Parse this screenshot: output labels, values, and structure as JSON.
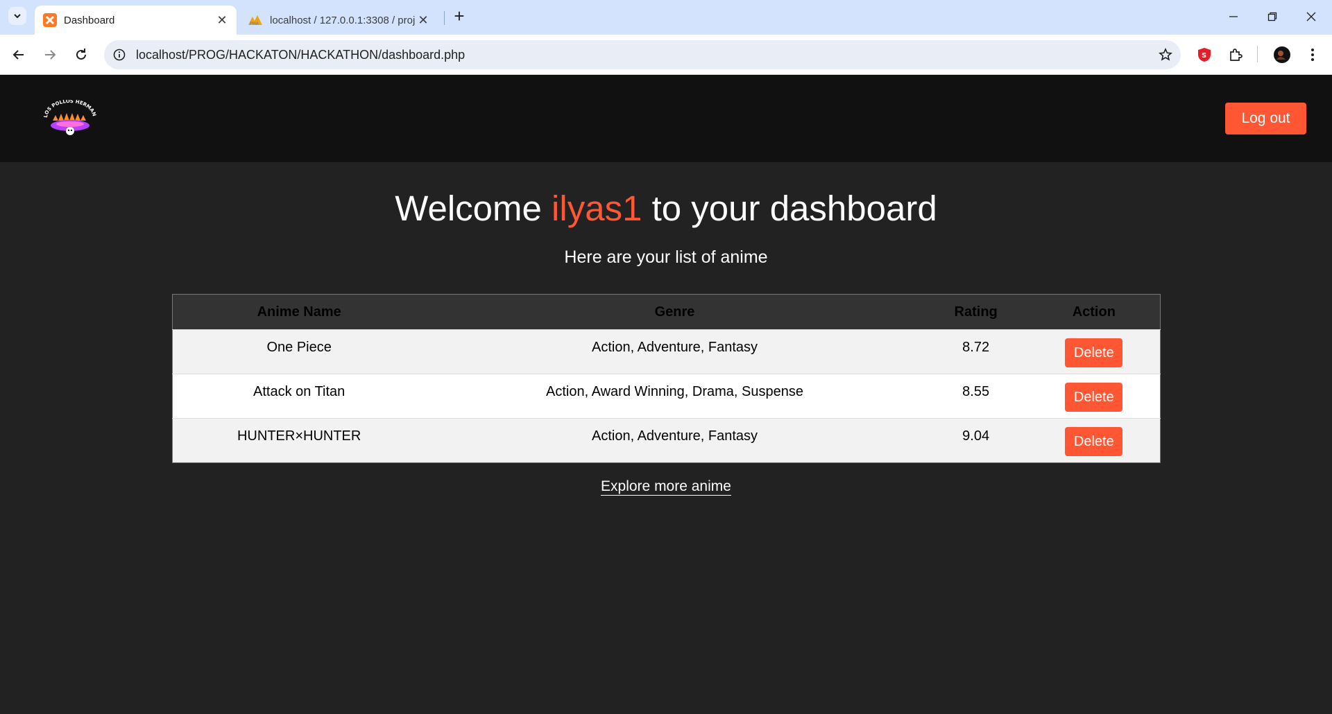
{
  "browser": {
    "tabs": [
      {
        "label": "Dashboard",
        "active": true
      },
      {
        "label": "localhost / 127.0.0.1:3308 / proj",
        "active": false
      }
    ],
    "url": "localhost/PROG/HACKATON/HACKATHON/dashboard.php"
  },
  "header": {
    "logo_text": "LOS POLLOS HERMANOS",
    "logout_label": "Log out"
  },
  "welcome": {
    "prefix": "Welcome ",
    "username": "ilyas1",
    "suffix": " to your dashboard",
    "subtitle": "Here are your list of anime"
  },
  "table": {
    "headers": {
      "name": "Anime Name",
      "genre": "Genre",
      "rating": "Rating",
      "action": "Action"
    },
    "rows": [
      {
        "name": "One Piece",
        "genre": "Action, Adventure, Fantasy",
        "rating": "8.72",
        "action": "Delete"
      },
      {
        "name": "Attack on Titan",
        "genre": "Action, Award Winning, Drama, Suspense",
        "rating": "8.55",
        "action": "Delete"
      },
      {
        "name": "HUNTER×HUNTER",
        "genre": "Action, Adventure, Fantasy",
        "rating": "9.04",
        "action": "Delete"
      }
    ]
  },
  "explore_label": "Explore more anime",
  "colors": {
    "accent": "#ff5733",
    "page_bg": "#222222",
    "header_bg": "#111111"
  }
}
